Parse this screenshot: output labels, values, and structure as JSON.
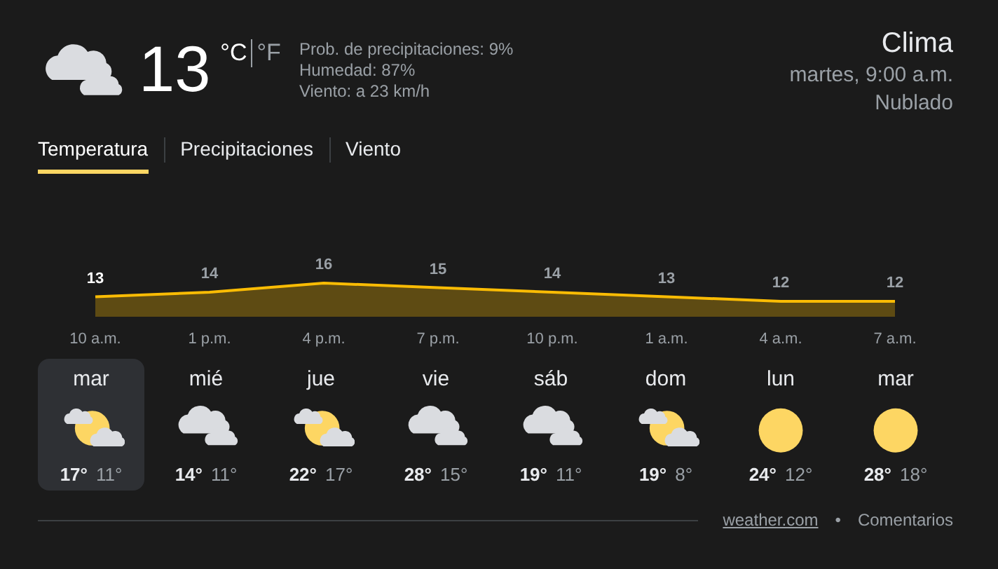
{
  "current": {
    "kind": "cloudy",
    "temperature": "13",
    "units": [
      {
        "label": "°C",
        "selected": true
      },
      {
        "label": "°F",
        "selected": false
      }
    ],
    "details": [
      "Prob. de precipitaciones: 9%",
      "Humedad: 87%",
      "Viento: a 23 km/h"
    ]
  },
  "location": {
    "title": "Clima",
    "time": "martes, 9:00 a.m.",
    "condition": "Nublado"
  },
  "tabs": [
    {
      "label": "Temperatura",
      "selected": true
    },
    {
      "label": "Precipitaciones",
      "selected": false
    },
    {
      "label": "Viento",
      "selected": false
    }
  ],
  "chart": {
    "chart_data": {
      "type": "area",
      "categories": [
        "10 a.m.",
        "1 p.m.",
        "4 p.m.",
        "7 p.m.",
        "10 p.m.",
        "1 a.m.",
        "4 a.m.",
        "7 a.m."
      ],
      "series": [
        {
          "color": "#fbbc04",
          "values": [
            13,
            14,
            16,
            15,
            14,
            13,
            12,
            12
          ]
        }
      ],
      "data_labels": true
    }
  },
  "days": [
    {
      "name": "mar",
      "kind": "partly-cloudy",
      "high": "17°",
      "low": "11°",
      "selected": true
    },
    {
      "name": "mié",
      "kind": "cloudy",
      "high": "14°",
      "low": "11°",
      "selected": false
    },
    {
      "name": "jue",
      "kind": "partly-cloudy",
      "high": "22°",
      "low": "17°",
      "selected": false
    },
    {
      "name": "vie",
      "kind": "cloudy",
      "high": "28°",
      "low": "15°",
      "selected": false
    },
    {
      "name": "sáb",
      "kind": "cloudy",
      "high": "19°",
      "low": "11°",
      "selected": false
    },
    {
      "name": "dom",
      "kind": "partly-cloudy",
      "high": "19°",
      "low": "8°",
      "selected": false
    },
    {
      "name": "lun",
      "kind": "sunny",
      "high": "24°",
      "low": "12°",
      "selected": false
    },
    {
      "name": "mar",
      "kind": "sunny",
      "high": "28°",
      "low": "18°",
      "selected": false
    }
  ],
  "footer": {
    "source": "weather.com",
    "separator": "•",
    "feedback": "Comentarios"
  }
}
